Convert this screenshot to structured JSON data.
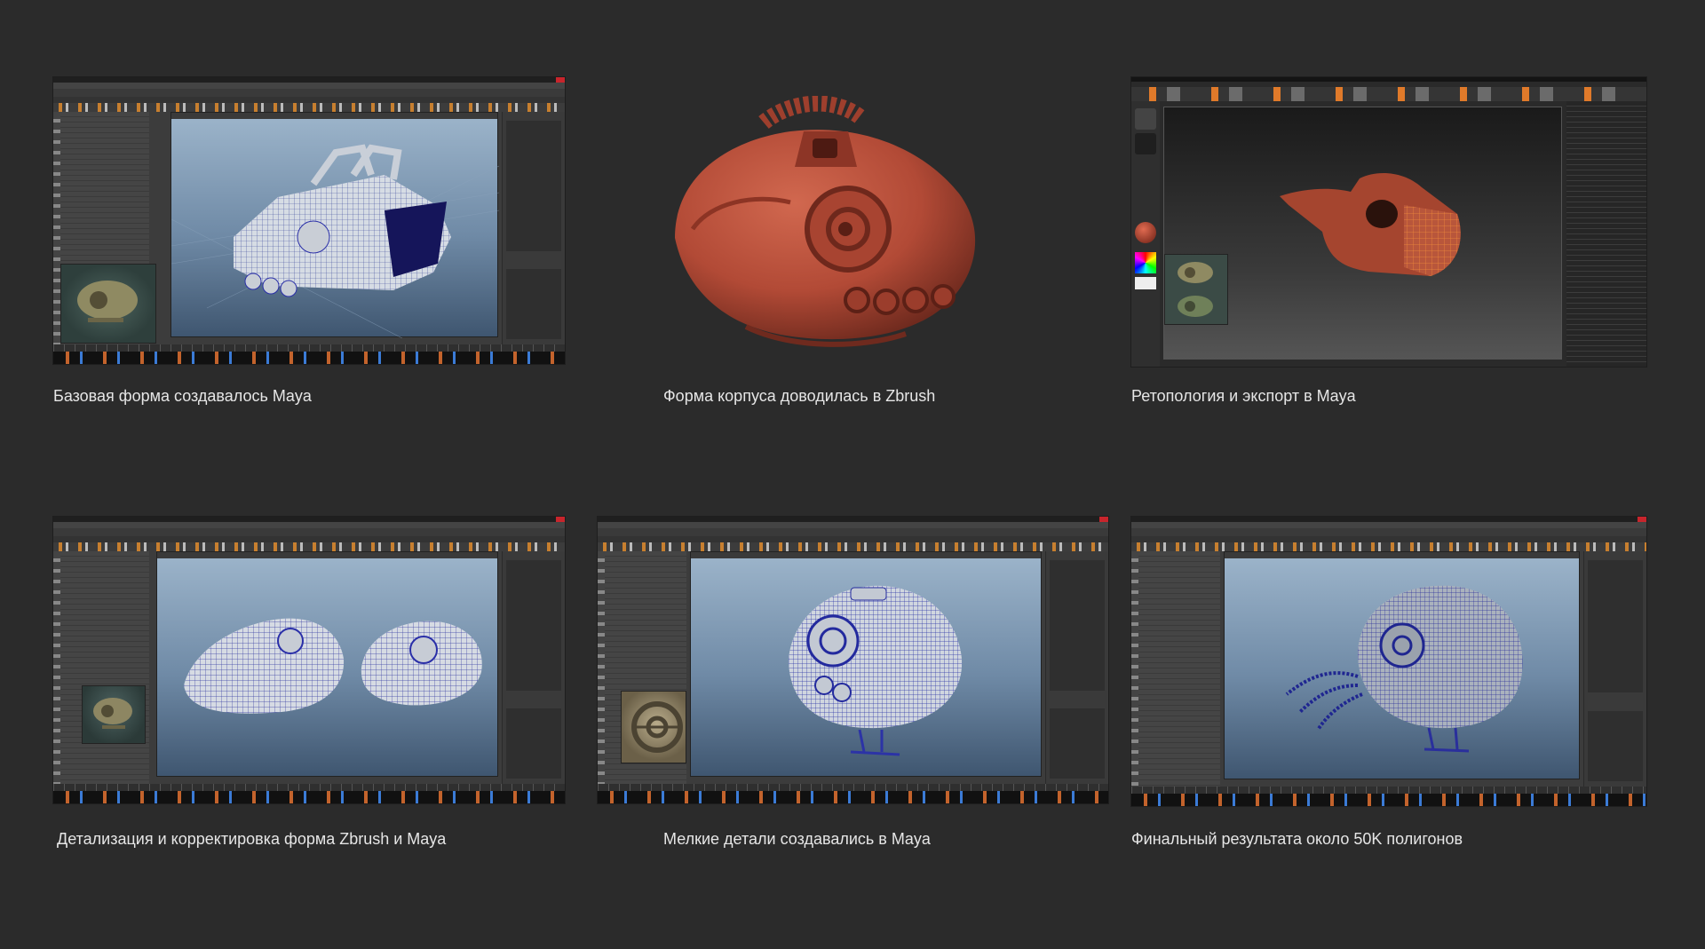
{
  "tiles": [
    {
      "caption": "Базовая форма создавалось Maya",
      "app": "maya",
      "view": "base"
    },
    {
      "caption": "Форма корпуса доводилась в Zbrush",
      "app": "render",
      "view": "sculpt"
    },
    {
      "caption": "Ретопология и экспорт в Maya",
      "app": "zbrush",
      "view": "retopo"
    },
    {
      "caption": "Детализация и корректировка форма Zbrush и Maya",
      "app": "maya",
      "view": "detail"
    },
    {
      "caption": "Мелкие детали создавались в Maya",
      "app": "maya",
      "view": "small-details"
    },
    {
      "caption": "Финальный результата около 50K полигонов",
      "app": "maya",
      "view": "final"
    }
  ],
  "colors": {
    "background": "#2b2b2b",
    "caption_text": "#e6e6e6",
    "sculpt_clay": "#b24a36",
    "zbrush_accent": "#e07a2a",
    "maya_close": "#c8252c",
    "wireframe": "#2a2fa8"
  }
}
